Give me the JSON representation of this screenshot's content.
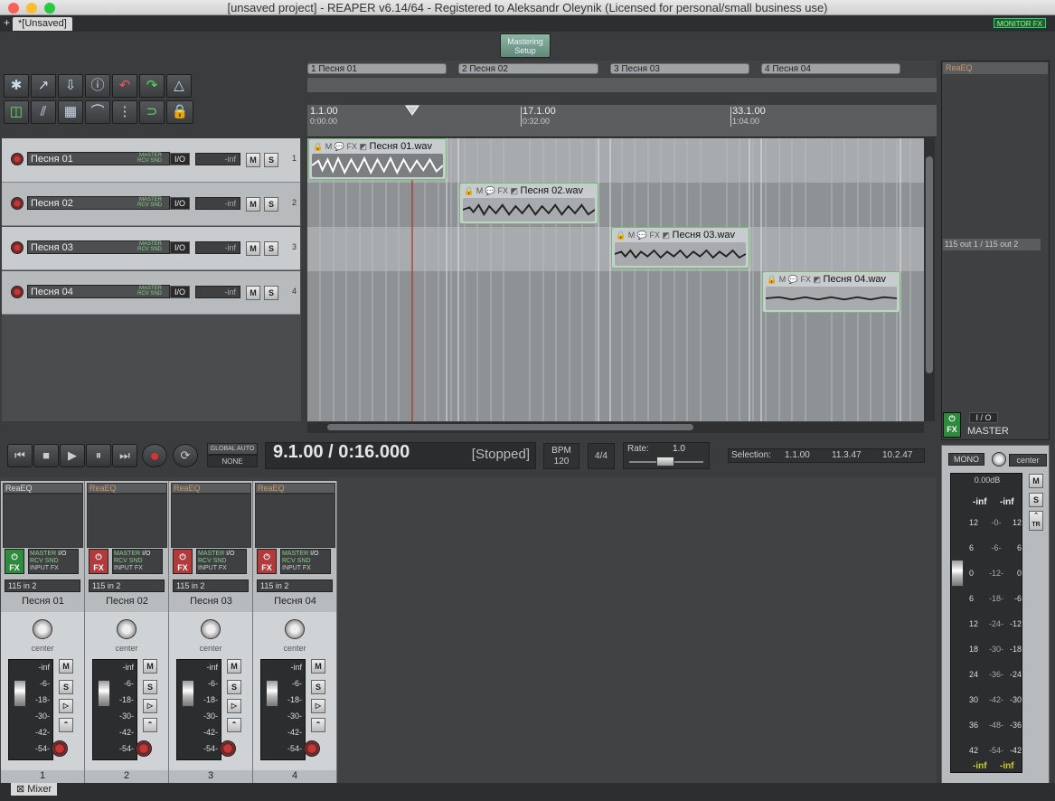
{
  "window": {
    "title": "[unsaved project] - REAPER v6.14/64 - Registered to Aleksandr Oleynik (Licensed for personal/small business use)"
  },
  "tabs": {
    "add": "+",
    "project": "*[Unsaved]",
    "monitor_fx": "MONITOR FX"
  },
  "mastering_button": "Mastering Setup",
  "regions": [
    {
      "label": "1  Песня 01"
    },
    {
      "label": "2  Песня 02"
    },
    {
      "label": "3  Песня 03"
    },
    {
      "label": "4  Песня 04"
    }
  ],
  "ruler": [
    {
      "bar": "1.1.00",
      "time": "0:00.00"
    },
    {
      "bar": "17.1.00",
      "time": "0:32.00"
    },
    {
      "bar": "33.1.00",
      "time": "1:04.00"
    }
  ],
  "tracks": [
    {
      "num": "1",
      "name": "Песня 01",
      "vol": "-inf",
      "item": "Песня 01.wav"
    },
    {
      "num": "2",
      "name": "Песня 02",
      "vol": "-inf",
      "item": "Песня 02.wav"
    },
    {
      "num": "3",
      "name": "Песня 03",
      "vol": "-inf",
      "item": "Песня 03.wav"
    },
    {
      "num": "4",
      "name": "Песня 04",
      "vol": "-inf",
      "item": "Песня 04.wav"
    }
  ],
  "labels": {
    "master_send": "MASTER",
    "rcv_snd": "RCV SND",
    "io": "I/O",
    "mute": "M",
    "solo": "S",
    "item_flags": "M",
    "item_fx": "FX",
    "fx": "FX",
    "input_fx": "INPUT FX",
    "center": "center",
    "tr": "TR"
  },
  "transport": {
    "global_auto": "GLOBAL AUTO",
    "global_auto_mode": "NONE",
    "position": "9.1.00 / 0:16.000",
    "state": "[Stopped]",
    "bpm_label": "BPM",
    "bpm": "120",
    "timesig": "4/4",
    "rate_label": "Rate:",
    "rate": "1.0",
    "selection_label": "Selection:",
    "sel_start": "1.1.00",
    "sel_end": "11.3.47",
    "sel_len": "10.2.47"
  },
  "fx_browser": {
    "header": "ReaEQ",
    "routing": "115 out 1 / 115 out 2"
  },
  "mixer": {
    "tab": "Mixer",
    "fx_slot": "ReaEQ",
    "input": "115 in 2",
    "scale": [
      "-inf",
      "-6-",
      "-18-",
      "-30-",
      "-42-",
      "-54-"
    ],
    "channels": [
      {
        "name": "Песня 01",
        "num": "1"
      },
      {
        "name": "Песня 02",
        "num": "2"
      },
      {
        "name": "Песня 03",
        "num": "3"
      },
      {
        "name": "Песня 04",
        "num": "4"
      }
    ]
  },
  "master": {
    "name": "MASTER",
    "io": "I / O",
    "mono": "MONO",
    "pan": "center",
    "db": "0.00dB",
    "peak_l": "-inf",
    "peak_r": "-inf",
    "fader_scale": [
      "12",
      "6",
      "0",
      "6",
      "12",
      "18",
      "24",
      "30",
      "36",
      "42"
    ],
    "meter_scale": [
      "-0-",
      "-6-",
      "-12-",
      "-18-",
      "-24-",
      "-30-",
      "-36-",
      "-42-",
      "-48-",
      "-54-"
    ],
    "right_scale": [
      "12",
      "6",
      "0",
      "-6",
      "-12",
      "-18",
      "-24",
      "-30",
      "-36",
      "-42"
    ],
    "bottom_l": "-inf",
    "bottom_r": "-inf"
  },
  "colors": {
    "accent_green": "#6cbe6c",
    "record_red": "#cc3333",
    "panel": "#b7bbbe"
  }
}
